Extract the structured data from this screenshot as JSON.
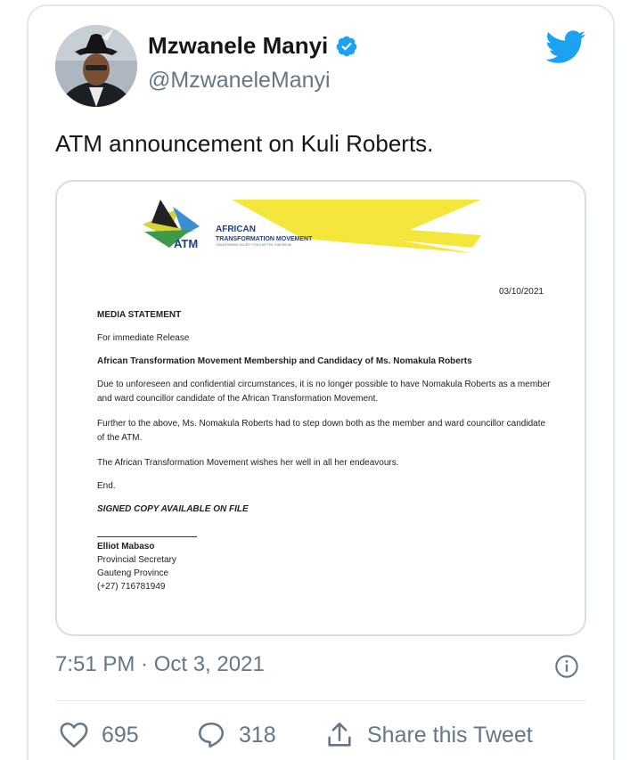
{
  "tweet": {
    "display_name": "Mzwanele Manyi",
    "handle": "@MzwaneleManyi",
    "text": "ATM announcement on Kuli Roberts.",
    "timestamp": "7:51 PM · Oct 3, 2021",
    "likes": "695",
    "replies": "318",
    "share_label": "Share this Tweet",
    "brand_color": "#1da1f2",
    "verified_color": "#1da1f2"
  },
  "document": {
    "logo_title": "AFRICAN",
    "logo_subtitle": "TRANSFORMATION MOVEMENT",
    "logo_tagline": "TRANSFORMING SOCIETY FOR A BETTER TOMORROW",
    "logo_abbr": "ATM",
    "date": "03/10/2021",
    "heading": "MEDIA STATEMENT",
    "release": "For immediate Release",
    "subject": "African Transformation Movement Membership and Candidacy of Ms. Nomakula Roberts",
    "para1": "Due to unforeseen and confidential circumstances, it is no longer possible to have Nomakula Roberts as a member and ward councillor candidate of the African Transformation Movement.",
    "para2": "Further to the above, Ms. Nomakula Roberts had to step down both as the member and ward councillor candidate of the ATM.",
    "para3": "The African Transformation Movement wishes her well in all her endeavours.",
    "end": "End.",
    "signed": "SIGNED COPY AVAILABLE ON FILE",
    "signatory": "Elliot Mabaso",
    "role": "Provincial Secretary",
    "province": "Gauteng Province",
    "phone": "(+27) 716781949"
  },
  "icons": [
    "twitter-bird-icon",
    "verified-icon",
    "info-icon",
    "heart-icon",
    "reply-icon",
    "share-icon"
  ]
}
